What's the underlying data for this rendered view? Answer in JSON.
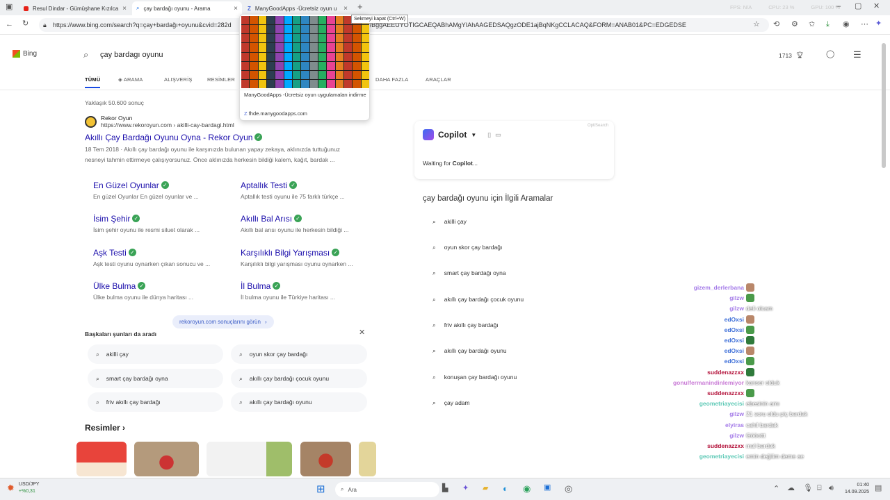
{
  "tabs": [
    {
      "title": "Resul Dindar - Gümüşhane Kızılca"
    },
    {
      "title": "çay bardağı oyunu - Arama"
    },
    {
      "title": "ManyGoodApps -Ücretsiz oyun u"
    }
  ],
  "tooltip": "Sekmeyi kapat (Ctrl+W)",
  "stats": {
    "fps": "FPS: N/A",
    "cpu": "CPU: 23 %",
    "gpu": "GPU: 100 %"
  },
  "url": "https://www.bing.com/search?q=çay+bardağı+oyunu&cvid=282d",
  "url_tail": "DkyBggAEEUYOTIGCAEQABhAMgYIAhAAGEDSAQgzODE1ajBqNKgCCLACAQ&FORM=ANAB01&PC=EDGEDSE",
  "preview": {
    "title": "ManyGoodApps -Ücretsiz oyun uygulamaları indirme",
    "domain": "fhde.manygoodapps.com"
  },
  "bing": {
    "logo": "Bing",
    "query": "çay bardagı oyunu",
    "count_badge": "1713",
    "nav": [
      "TÜMÜ",
      "ARAMA",
      "ALIŞVERİŞ",
      "RESİMLER",
      "DAHA FAZLA",
      "ARAÇLAR"
    ]
  },
  "result_count": "Yaklaşık 50.600 sonuç",
  "result": {
    "site": "Rekor Oyun",
    "cite": "https://www.rekoroyun.com › akilli-cay-bardagi.html",
    "title": "Akıllı Çay Bardağı Oyunu Oyna - Rekor Oyun",
    "snippet1": "18 Tem 2018 · Akıllı çay bardağı oyunu ile karşınızda bulunan yapay zekaya, aklınızda tuttuğunuz",
    "snippet2": "nesneyi tahmin ettirmeye çalışıyorsunuz. Önce aklınızda herkesin bildiği kalem, kağıt, bardak ..."
  },
  "sitelinks": [
    {
      "title": "En Güzel Oyunlar",
      "snip": "En güzel Oyunlar En güzel oyunlar ve ..."
    },
    {
      "title": "Aptallık Testi",
      "snip": "Aptallık testi oyunu ile 75 farklı türkçe ..."
    },
    {
      "title": "İsim Şehir",
      "snip": "İsim şehir oyunu ile resmi siluet olarak ..."
    },
    {
      "title": "Akıllı Bal Arısı",
      "snip": "Akıllı bal arısı oyunu ile herkesin bildiği ..."
    },
    {
      "title": "Aşk Testi",
      "snip": "Aşk testi oyunu oynarken çıkan sonucu ve ..."
    },
    {
      "title": "Karşılıklı Bilgi Yarışması",
      "snip": "Karşılıklı bilgi yarışması oyunu oynarken ..."
    },
    {
      "title": "Ülke Bulma",
      "snip": "Ülke bulma oyunu ile dünya haritası ..."
    },
    {
      "title": "İl Bulma",
      "snip": "İl bulma oyunu ile Türkiye haritası ..."
    }
  ],
  "more_results": "rekoroyun.com sonuçlarını görün",
  "also_asked": {
    "title": "Başkaları şunları da aradı",
    "items": [
      "akilli çay",
      "oyun skor çay bardağı",
      "smart çay bardağı oyna",
      "akıllı çay bardağı çocuk oyunu",
      "friv akıllı çay bardağı",
      "akıllı çay bardağı oyunu"
    ]
  },
  "images_title": "Resimler",
  "copilot": {
    "name": "Copilot",
    "badge": "OptiSearch",
    "waiting_prefix": "Waiting for ",
    "waiting_name": "Copilot",
    "waiting_suffix": "..."
  },
  "related": {
    "title": "çay bardağı oyunu için İlgili Aramalar",
    "items": [
      "akilli çay",
      "oyun skor çay bardağı",
      "smart çay bardağı oyna",
      "akıllı çay bardağı çocuk oyunu",
      "friv akıllı çay bardağı",
      "akıllı çay bardağı oyunu",
      "konuşan çay bardağı oyunu",
      "çay adam"
    ]
  },
  "chat": [
    {
      "user": "gizem_derlerbana",
      "color": "#a47be8",
      "msg": ""
    },
    {
      "user": "gilzw",
      "color": "#a47be8",
      "msg": ""
    },
    {
      "user": "gilzw",
      "color": "#a47be8",
      "msg": "deli olcam"
    },
    {
      "user": "edOxsi",
      "color": "#3e6fd8",
      "msg": ""
    },
    {
      "user": "edOxsi",
      "color": "#3e6fd8",
      "msg": ""
    },
    {
      "user": "edOxsi",
      "color": "#3e6fd8",
      "msg": ""
    },
    {
      "user": "edOxsi",
      "color": "#3e6fd8",
      "msg": ""
    },
    {
      "user": "edOxsi",
      "color": "#3e6fd8",
      "msg": ""
    },
    {
      "user": "suddenazzxx",
      "color": "#b3123a",
      "msg": ""
    },
    {
      "user": "gonulfermanindinlemiyor",
      "color": "#c97bd6",
      "msg": "kanser olduk"
    },
    {
      "user": "suddenazzxx",
      "color": "#b3123a",
      "msg": ""
    },
    {
      "user": "geometriayecisi",
      "color": "#5ec9b6",
      "msg": "ebesinin amı"
    },
    {
      "user": "gilzw",
      "color": "#a47be8",
      "msg": "21 soru oldu piç bardak"
    },
    {
      "user": "elyiras",
      "color": "#a47be8",
      "msg": "cahil bardak"
    },
    {
      "user": "gilzw",
      "color": "#a47be8",
      "msg": "Gööottt"
    },
    {
      "user": "suddenazzxx",
      "color": "#b3123a",
      "msg": "mal bardak"
    },
    {
      "user": "geometriayecisi",
      "color": "#5ec9b6",
      "msg": "emin değilim deme ae"
    }
  ],
  "taskbar": {
    "ticker": "USD/JPY",
    "ticker_change": "+%0,31",
    "search": "Ara",
    "time": "01:40",
    "date": "14.09.2025"
  }
}
